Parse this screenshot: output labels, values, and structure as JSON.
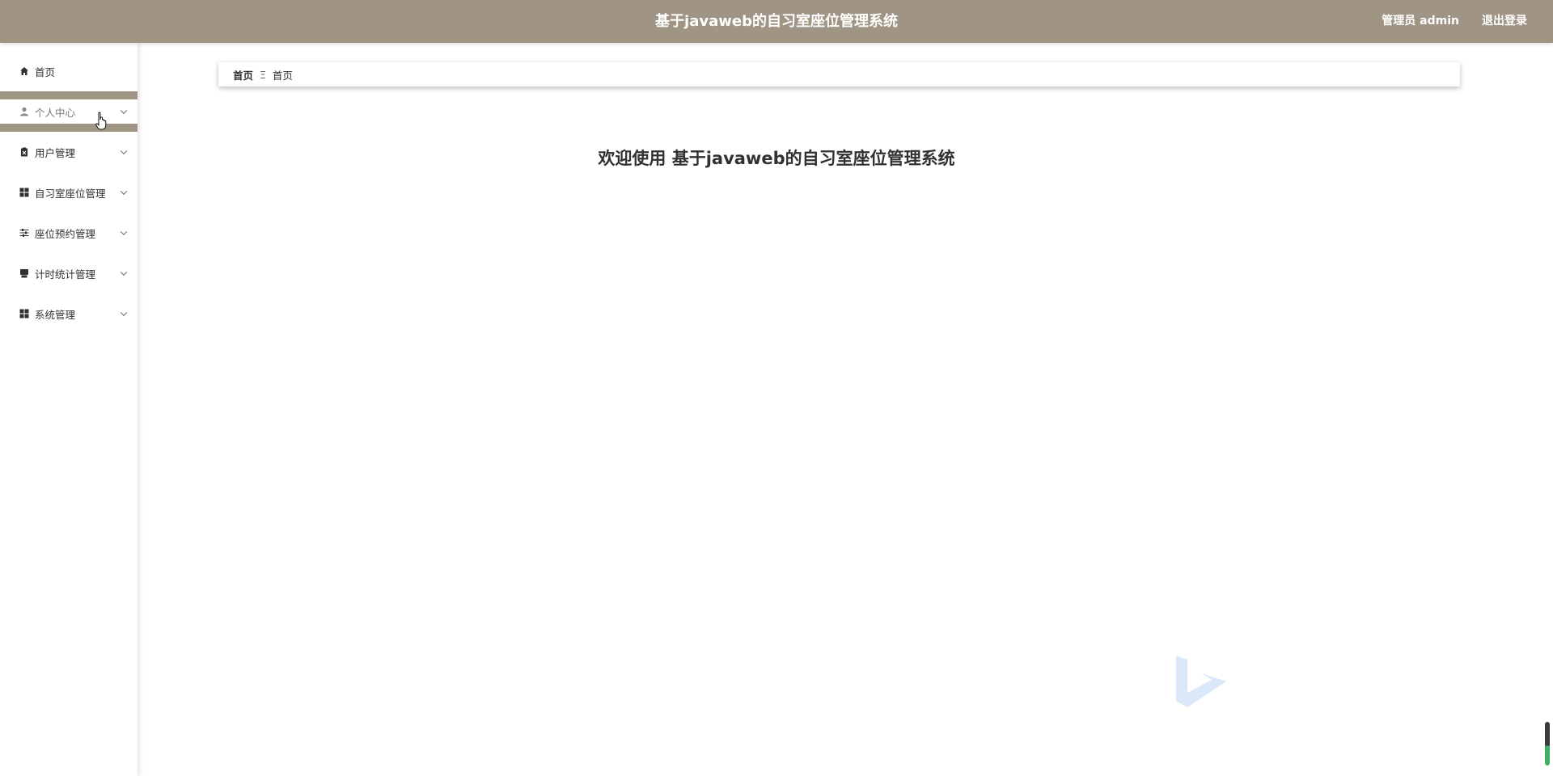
{
  "header": {
    "title": "基于javaweb的自习室座位管理系统",
    "user_label": "管理员 admin",
    "logout_label": "退出登录",
    "bg_color": "#a09584"
  },
  "sidebar": {
    "items": [
      {
        "label": "首页",
        "icon": "home-icon"
      },
      {
        "label": "个人中心",
        "icon": "user-icon",
        "active": true
      },
      {
        "label": "用户管理",
        "icon": "clipboard-icon"
      },
      {
        "label": "自习室座位管理",
        "icon": "grid-icon"
      },
      {
        "label": "座位预约管理",
        "icon": "sliders-icon"
      },
      {
        "label": "计时统计管理",
        "icon": "printer-icon"
      },
      {
        "label": "系统管理",
        "icon": "grid-icon"
      }
    ]
  },
  "breadcrumb": {
    "home": "首页",
    "separator": "Ξ",
    "current": "首页"
  },
  "main": {
    "welcome": "欢迎使用 基于javaweb的自习室座位管理系统"
  }
}
